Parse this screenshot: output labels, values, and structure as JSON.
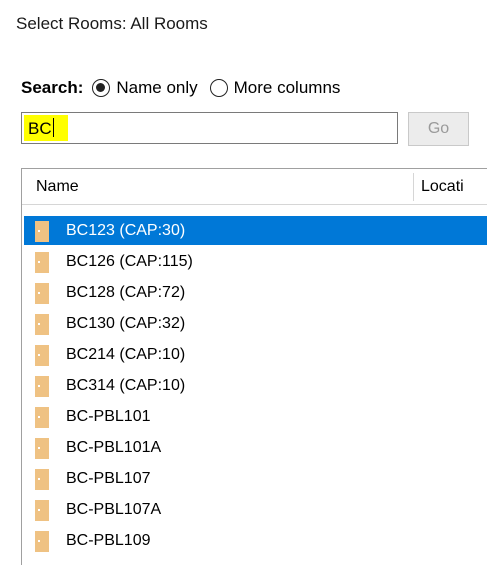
{
  "dialog": {
    "title": "Select Rooms: All Rooms"
  },
  "search": {
    "label": "Search:",
    "options": [
      {
        "label": "Name only",
        "checked": true
      },
      {
        "label": "More columns",
        "checked": false
      }
    ],
    "value": "BC",
    "highlight_color": "#ffff00",
    "go_label": "Go"
  },
  "list": {
    "columns": [
      "Name",
      "Locati"
    ],
    "selected_index": 0,
    "selection_color": "#0078d7",
    "icon": "room-icon",
    "icon_color": "#efc283",
    "rows": [
      "BC123 (CAP:30)",
      "BC126 (CAP:115)",
      "BC128 (CAP:72)",
      "BC130 (CAP:32)",
      "BC214 (CAP:10)",
      "BC314 (CAP:10)",
      "BC-PBL101",
      "BC-PBL101A",
      "BC-PBL107",
      "BC-PBL107A",
      "BC-PBL109"
    ]
  }
}
